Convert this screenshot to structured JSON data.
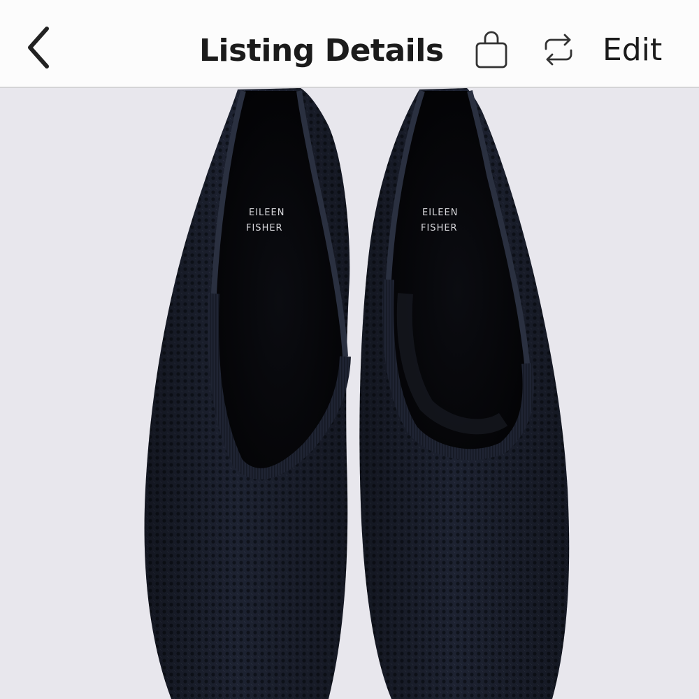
{
  "header": {
    "title": "Listing Details",
    "edit_label": "Edit",
    "icons": {
      "back": "chevron-left-icon",
      "bag": "shopping-bag-icon",
      "share": "repost-icon"
    }
  },
  "photo": {
    "subject": "pair of knit flats",
    "insole_brand_lines": [
      "EILEEN",
      "FISHER"
    ],
    "colors": {
      "background": "#e8e7ed",
      "shoe_knit": "#1c2230",
      "shoe_lining": "#05060a"
    }
  }
}
